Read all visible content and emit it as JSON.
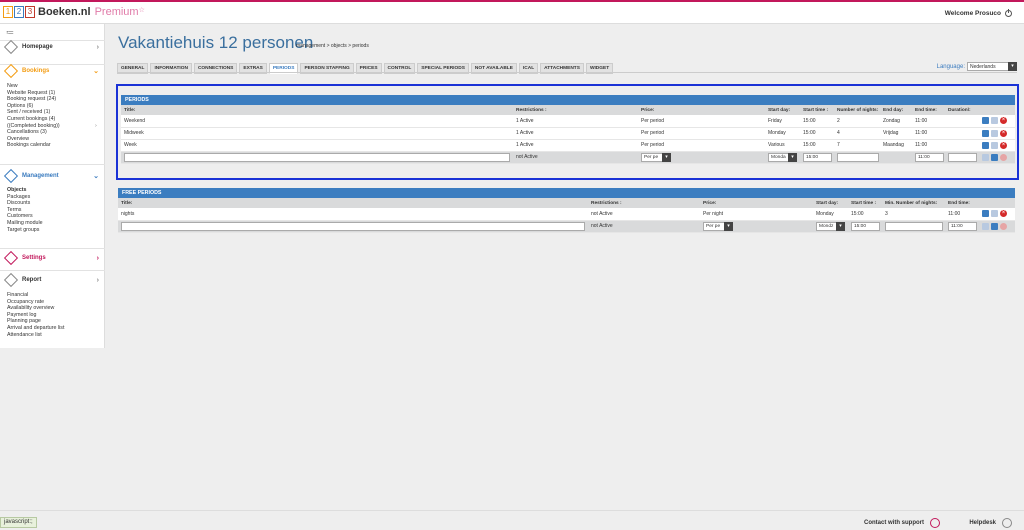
{
  "header": {
    "logo_digits": [
      "1",
      "2",
      "3"
    ],
    "brand": "Boeken.nl",
    "premium": "Premium",
    "star": "☆",
    "welcome": "Welcome Prosuco",
    "power_icon": "power-icon"
  },
  "sidebar": {
    "menu_icon": "≔",
    "homepage": "Homepage",
    "bookings": {
      "label": "Bookings",
      "items": [
        "New",
        "Website Request (1)",
        "Booking request (24)",
        "Options (6)",
        "Sent / received (1)",
        "Current bookings (4)",
        "((Completed booking))",
        "Cancellations (3)",
        "Overview",
        "Bookings calendar"
      ]
    },
    "management": {
      "label": "Management",
      "items": [
        "Objects",
        "Packages",
        "Discounts",
        "Terms",
        "Customers",
        "Mailing module",
        "Target groups"
      ]
    },
    "settings": "Settings",
    "report": {
      "label": "Report",
      "items": [
        "Financial",
        "Occupancy rate",
        "Availability overview",
        "Payment log",
        "Planning page",
        "Arrival and departure list",
        "Attendance list"
      ]
    }
  },
  "main": {
    "title": "Vakantiehuis 12 personen",
    "breadcrumb": "management > objects > periods",
    "tabs": [
      "GENERAL",
      "INFORMATION",
      "CONNECTIONS",
      "EXTRAS",
      "PERIODS",
      "PERSON STAFFING",
      "PRICES",
      "CONTROL",
      "SPECIAL PERIODS",
      "NOT AVAILABLE",
      "ICAL",
      "ATTACHMENTS",
      "WIDGET"
    ],
    "language_label": "Language:",
    "language_value": "Nederlands"
  },
  "periods": {
    "heading": "PERIODS",
    "columns": [
      "Title:",
      "Restrictions :",
      "Price:",
      "Start day:",
      "Start time :",
      "Number of nights:",
      "End day:",
      "End time:",
      "Duration\\:"
    ],
    "rows": [
      [
        "Weekend",
        "1 Active",
        "Per period",
        "Friday",
        "15:00",
        "2",
        "Zondag",
        "11:00",
        ""
      ],
      [
        "Midweek",
        "1 Active",
        "Per period",
        "Monday",
        "15:00",
        "4",
        "Vrijdag",
        "11:00",
        ""
      ],
      [
        "Week",
        "1 Active",
        "Per period",
        "Various",
        "15:00",
        "7",
        "Maandag",
        "11:00",
        ""
      ]
    ],
    "add_row": {
      "restriction": "not Active",
      "price": "Per pe",
      "start_day": "Monda",
      "start_time": "15:00",
      "end_time": "11:00"
    }
  },
  "free_periods": {
    "heading": "FREE PERIODS",
    "columns": [
      "Title:",
      "Restrictions :",
      "Price:",
      "Start day:",
      "Start time :",
      "Min. Number of nights:",
      "End time:"
    ],
    "rows": [
      [
        "nights",
        "not Active",
        "Per night",
        "Monday",
        "15:00",
        "3",
        "11:00"
      ]
    ],
    "add_row": {
      "restriction": "not Active",
      "price": "Per pe",
      "start_day": "Mondz",
      "start_time": "15:00",
      "end_time": "11:00"
    }
  },
  "footer": {
    "contact": "Contact with support",
    "helpdesk": "Helpdesk",
    "status_bar": "javascript:;"
  },
  "colors": {
    "accent": "#3b7dc0",
    "highlight": "#1a32d6",
    "bookings": "#f39c12",
    "settings": "#c2185b"
  }
}
